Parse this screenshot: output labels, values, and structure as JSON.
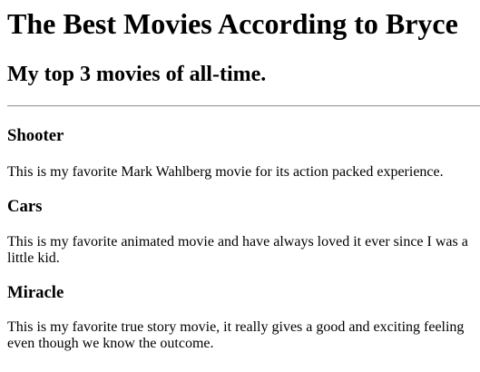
{
  "page": {
    "title": "The Best Movies According to Bryce",
    "subtitle": "My top 3 movies of all-time."
  },
  "movies": [
    {
      "title": "Shooter",
      "description": "This is my favorite Mark Wahlberg movie for its action packed experience."
    },
    {
      "title": "Cars",
      "description": "This is my favorite animated movie and have always loved it ever since I was a little kid."
    },
    {
      "title": "Miracle",
      "description": "This is my favorite true story movie, it really gives a good and exciting feeling even though we know the outcome."
    }
  ]
}
